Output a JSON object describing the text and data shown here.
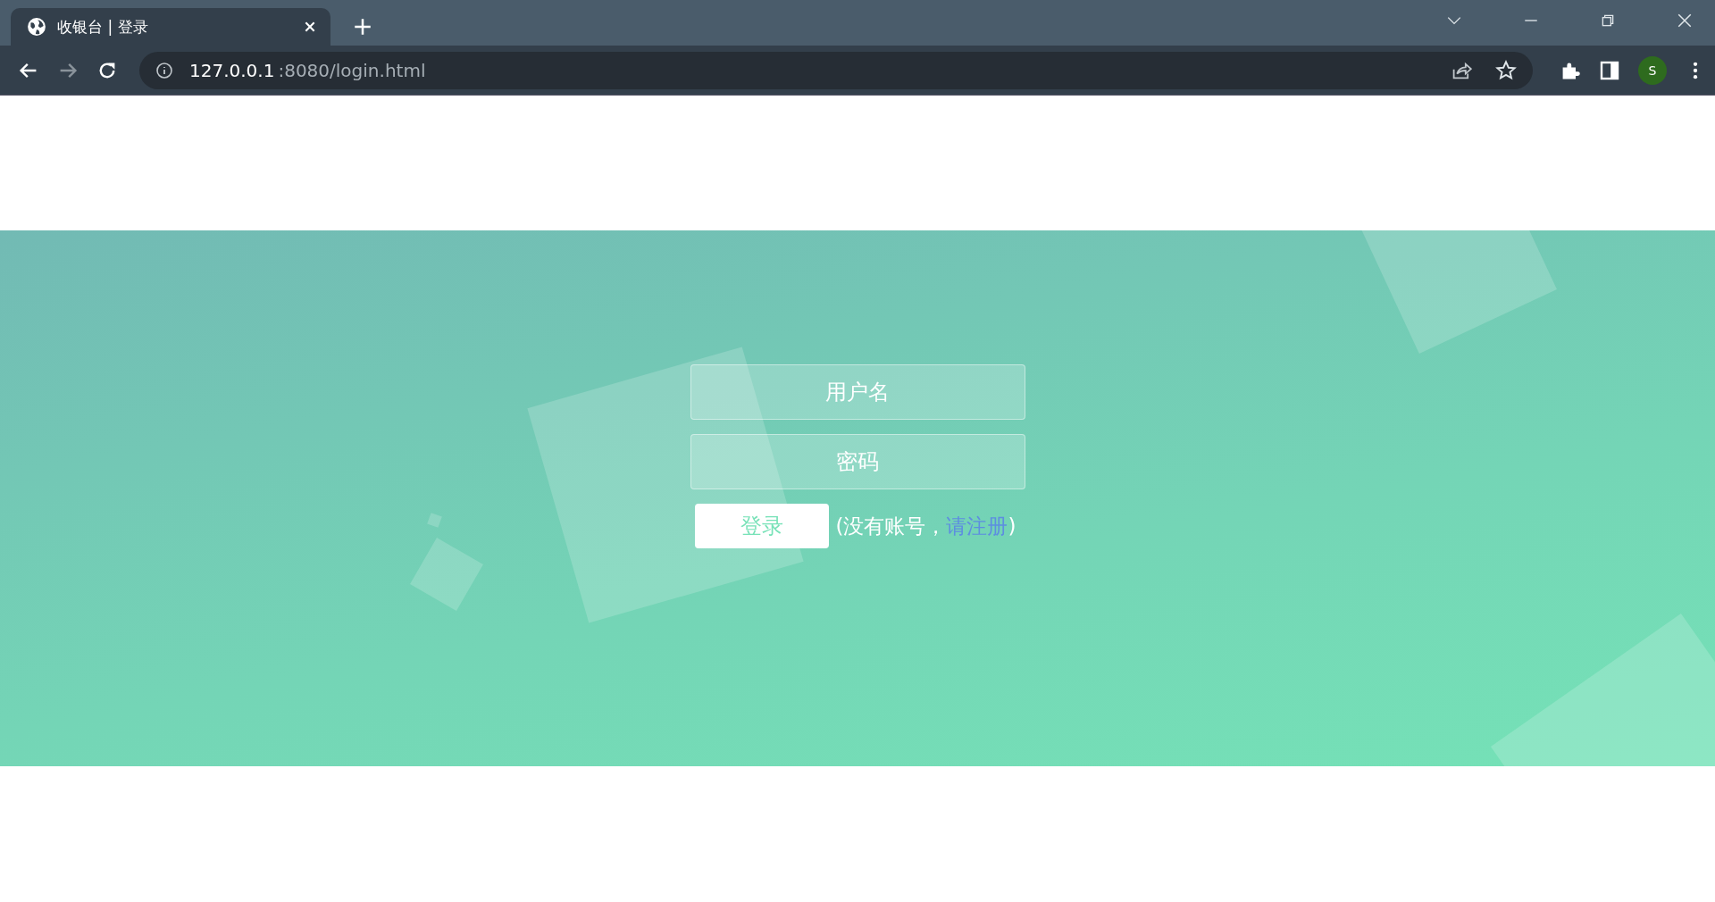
{
  "browser": {
    "tab": {
      "title": "收银台 | 登录",
      "selected": true
    },
    "address": {
      "host": "127.0.0.1",
      "path": ":8080/login.html"
    },
    "profile_initial": "S"
  },
  "login": {
    "username": {
      "placeholder": "用户名"
    },
    "password": {
      "placeholder": "密码"
    },
    "submit": "登录",
    "hint_prefix": "(没有账号，",
    "register_link": "请注册",
    "hint_suffix": ")"
  }
}
